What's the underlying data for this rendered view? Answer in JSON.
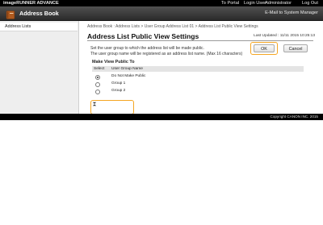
{
  "topbar": {
    "product": "imageRUNNER ADVANCE",
    "to_portal": "To Portal",
    "login_label": "Login User :",
    "login_user": "Administrator",
    "logout": "Log Out"
  },
  "appbar": {
    "title": "Address Book",
    "email_link": "E-Mail to System Manager"
  },
  "sidebar": {
    "items": [
      {
        "label": "Address Lists"
      }
    ]
  },
  "main": {
    "breadcrumb": "Address Book : Address Lists > User Group Address List 01 > Address List Public View Settings",
    "title": "Address List Public View Settings",
    "last_updated": "Last Updated : 11/11 2015 10:25:13",
    "description": [
      "Set the user group to which the address list will be made public.",
      "The user group name will be registered as an address list name. (Max 16 characters)"
    ],
    "ok_label": "OK",
    "cancel_label": "Cancel",
    "section_label": "Make View Public To",
    "table": {
      "headers": {
        "select": "Select",
        "name": "User Group Name"
      },
      "rows": [
        {
          "label": "Do Not Make Public",
          "checked": true
        },
        {
          "label": "Group 1",
          "checked": false
        },
        {
          "label": "Group 2",
          "checked": false
        }
      ]
    },
    "collapse_icon_name": "collapse-arrows-icon"
  },
  "footer": {
    "copyright": "Copyright CANON INC. 2015"
  },
  "colors": {
    "highlight": "#f5a623",
    "topbar": "#000000",
    "appbar": "#3a3a3a",
    "book_icon": "#b05a1e"
  }
}
